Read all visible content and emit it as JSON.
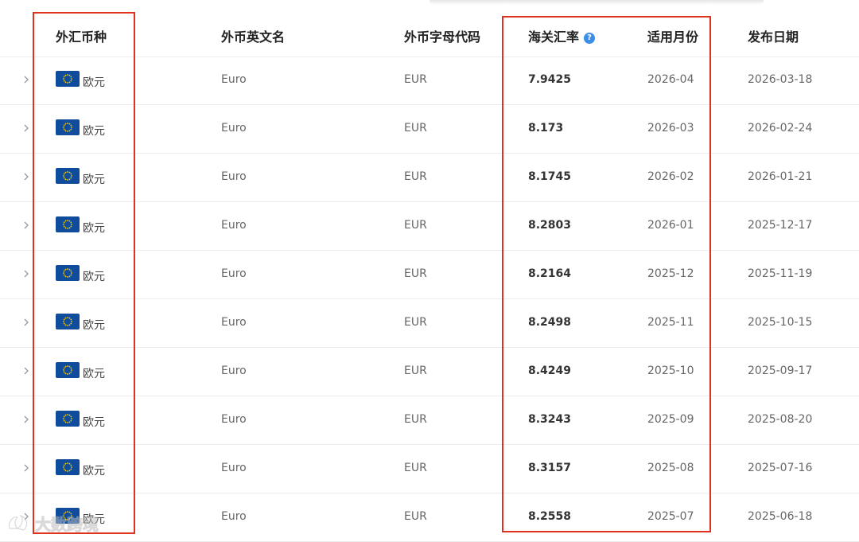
{
  "table": {
    "headers": {
      "currency": "外汇币种",
      "english_name": "外币英文名",
      "code": "外币字母代码",
      "rate": "海关汇率",
      "month": "适用月份",
      "publish_date": "发布日期"
    },
    "help_icon": "question-circle-icon",
    "rows": [
      {
        "currency": "欧元",
        "english_name": "Euro",
        "code": "EUR",
        "rate": "7.9425",
        "month": "2026-04",
        "publish_date": "2026-03-18"
      },
      {
        "currency": "欧元",
        "english_name": "Euro",
        "code": "EUR",
        "rate": "8.173",
        "month": "2026-03",
        "publish_date": "2026-02-24"
      },
      {
        "currency": "欧元",
        "english_name": "Euro",
        "code": "EUR",
        "rate": "8.1745",
        "month": "2026-02",
        "publish_date": "2026-01-21"
      },
      {
        "currency": "欧元",
        "english_name": "Euro",
        "code": "EUR",
        "rate": "8.2803",
        "month": "2026-01",
        "publish_date": "2025-12-17"
      },
      {
        "currency": "欧元",
        "english_name": "Euro",
        "code": "EUR",
        "rate": "8.2164",
        "month": "2025-12",
        "publish_date": "2025-11-19"
      },
      {
        "currency": "欧元",
        "english_name": "Euro",
        "code": "EUR",
        "rate": "8.2498",
        "month": "2025-11",
        "publish_date": "2025-10-15"
      },
      {
        "currency": "欧元",
        "english_name": "Euro",
        "code": "EUR",
        "rate": "8.4249",
        "month": "2025-10",
        "publish_date": "2025-09-17"
      },
      {
        "currency": "欧元",
        "english_name": "Euro",
        "code": "EUR",
        "rate": "8.3243",
        "month": "2025-09",
        "publish_date": "2025-08-20"
      },
      {
        "currency": "欧元",
        "english_name": "Euro",
        "code": "EUR",
        "rate": "8.3157",
        "month": "2025-08",
        "publish_date": "2025-07-16"
      },
      {
        "currency": "欧元",
        "english_name": "Euro",
        "code": "EUR",
        "rate": "8.2558",
        "month": "2025-07",
        "publish_date": "2025-06-18"
      }
    ]
  },
  "colors": {
    "highlight_box": "#e0301e",
    "help_icon": "#3a8ee6",
    "eu_flag_blue": "#0f4d9c",
    "eu_flag_star": "#ffcc00"
  },
  "watermark": {
    "text": "大数跨境"
  }
}
